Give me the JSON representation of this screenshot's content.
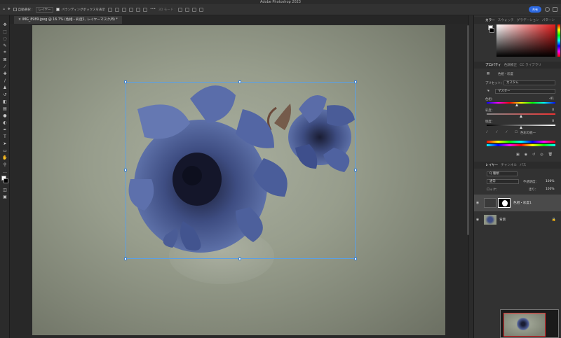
{
  "app": {
    "title": "Adobe Photoshop 2023"
  },
  "options": {
    "auto_select": "自動選択 :",
    "layer_mode": "レイヤー",
    "bounding_box": "バウンディングボックスを表示",
    "mode3d": "3D モード :",
    "share": "共有"
  },
  "document": {
    "tab_title": "IMG_8989.jpeg @ 16.7% (色相・彩度1, レイヤーマスク/8) *"
  },
  "color_panel": {
    "tabs": [
      "カラー",
      "スウォッチ",
      "グラデーション",
      "パターン"
    ]
  },
  "properties": {
    "tabs": [
      "プロパティ",
      "色調補正",
      "CC ライブラリ"
    ],
    "type": "色相・彩度",
    "preset_label": "プリセット：",
    "preset_value": "カスタム",
    "channel": "マスター",
    "hue_label": "色相：",
    "hue_value": "-41",
    "hue_fraction": 0.44,
    "saturation_label": "彩度：",
    "saturation_value": "0",
    "saturation_fraction": 0.5,
    "lightness_label": "明度：",
    "lightness_value": "0",
    "lightness_fraction": 0.5,
    "colorize": "色彩の統一"
  },
  "layers": {
    "tabs": [
      "レイヤー",
      "チャンネル",
      "パス"
    ],
    "kind": "Q 種類",
    "blend": "通常",
    "opacity_label": "不透明度：",
    "opacity": "100%",
    "lock_label": "ロック：",
    "fill_label": "塗り：",
    "fill": "100%",
    "items": [
      {
        "name": "色相・彩度1"
      },
      {
        "name": "背景"
      }
    ]
  }
}
